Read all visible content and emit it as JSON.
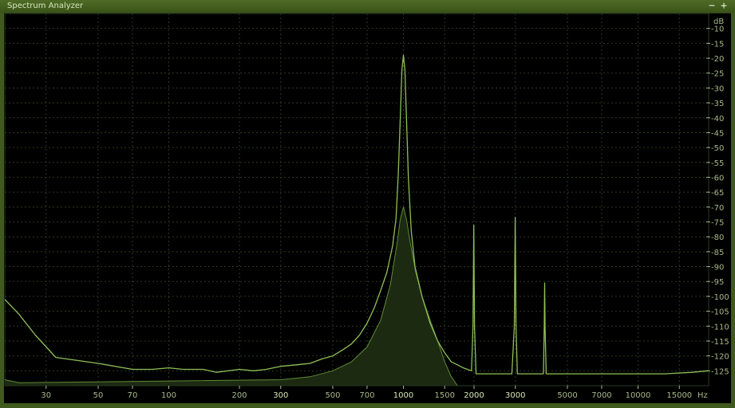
{
  "window": {
    "title": "Spectrum Analyzer",
    "minimize_label": "−",
    "maximize_label": "+"
  },
  "colors": {
    "frame": "#3f5a1c",
    "grid": "#2a3a22",
    "curve": "#8fbf57",
    "curve_dim": "#5f8a36",
    "fill": "#1d2a12",
    "text": "#a8b88a",
    "highlight": "#d9e9b5"
  },
  "chart_data": {
    "type": "line",
    "xscale": "log",
    "xlabel": "Hz",
    "ylabel": "dB",
    "xlim": [
      20,
      20000
    ],
    "ylim": [
      -130,
      -5
    ],
    "x_ticks": [
      30,
      50,
      70,
      100,
      200,
      300,
      500,
      700,
      1000,
      1500,
      2000,
      3000,
      5000,
      7000,
      10000,
      15000
    ],
    "x_ticks_highlight": [
      300,
      1000,
      2000,
      3000
    ],
    "y_ticks": [
      -10,
      -15,
      -20,
      -25,
      -30,
      -35,
      -40,
      -45,
      -50,
      -55,
      -60,
      -65,
      -70,
      -75,
      -80,
      -85,
      -90,
      -95,
      -100,
      -105,
      -110,
      -115,
      -120,
      -125
    ],
    "grid": true,
    "series": [
      {
        "role": "peak",
        "points": [
          [
            20,
            -101
          ],
          [
            23,
            -106
          ],
          [
            27,
            -113
          ],
          [
            33,
            -120.5
          ],
          [
            50,
            -122.5
          ],
          [
            70,
            -124.5
          ],
          [
            85,
            -124.5
          ],
          [
            100,
            -124
          ],
          [
            115,
            -124.5
          ],
          [
            140,
            -124.5
          ],
          [
            160,
            -125.5
          ],
          [
            200,
            -124.5
          ],
          [
            230,
            -125
          ],
          [
            260,
            -124.5
          ],
          [
            300,
            -123.5
          ],
          [
            350,
            -123
          ],
          [
            400,
            -122.5
          ],
          [
            450,
            -121
          ],
          [
            500,
            -120
          ],
          [
            550,
            -118
          ],
          [
            600,
            -116
          ],
          [
            650,
            -113
          ],
          [
            700,
            -109
          ],
          [
            750,
            -104
          ],
          [
            800,
            -98
          ],
          [
            850,
            -92
          ],
          [
            900,
            -83
          ],
          [
            930,
            -74
          ],
          [
            950,
            -60
          ],
          [
            970,
            -40
          ],
          [
            985,
            -24
          ],
          [
            1000,
            -19
          ],
          [
            1015,
            -24
          ],
          [
            1030,
            -40
          ],
          [
            1050,
            -60
          ],
          [
            1080,
            -78
          ],
          [
            1120,
            -90
          ],
          [
            1200,
            -100
          ],
          [
            1300,
            -109
          ],
          [
            1400,
            -115
          ],
          [
            1500,
            -119
          ],
          [
            1600,
            -122
          ],
          [
            1700,
            -123
          ],
          [
            1800,
            -124
          ],
          [
            1950,
            -125
          ],
          [
            1980,
            -110
          ],
          [
            1995,
            -76
          ],
          [
            2010,
            -110
          ],
          [
            2040,
            -126
          ],
          [
            2300,
            -126
          ],
          [
            2600,
            -126
          ],
          [
            2900,
            -126
          ],
          [
            2970,
            -110
          ],
          [
            2995,
            -73.5
          ],
          [
            3020,
            -110
          ],
          [
            3060,
            -126
          ],
          [
            3500,
            -126
          ],
          [
            3950,
            -126
          ],
          [
            3985,
            -110
          ],
          [
            4000,
            -95.5
          ],
          [
            4015,
            -110
          ],
          [
            4060,
            -126
          ],
          [
            5000,
            -126
          ],
          [
            6000,
            -126
          ],
          [
            7000,
            -126
          ],
          [
            8000,
            -126
          ],
          [
            10000,
            -126
          ],
          [
            13000,
            -126
          ],
          [
            17000,
            -125.5
          ],
          [
            20000,
            -125
          ]
        ]
      },
      {
        "role": "average",
        "points": [
          [
            20,
            -128
          ],
          [
            23,
            -129
          ],
          [
            300,
            -128
          ],
          [
            400,
            -127
          ],
          [
            500,
            -125
          ],
          [
            600,
            -122
          ],
          [
            700,
            -117
          ],
          [
            800,
            -108
          ],
          [
            880,
            -96
          ],
          [
            940,
            -82
          ],
          [
            970,
            -74
          ],
          [
            1000,
            -70
          ],
          [
            1030,
            -74
          ],
          [
            1070,
            -82
          ],
          [
            1130,
            -92
          ],
          [
            1200,
            -100
          ],
          [
            1300,
            -108
          ],
          [
            1400,
            -115
          ],
          [
            1500,
            -122
          ],
          [
            1600,
            -127
          ],
          [
            1700,
            -130
          ]
        ]
      }
    ]
  }
}
